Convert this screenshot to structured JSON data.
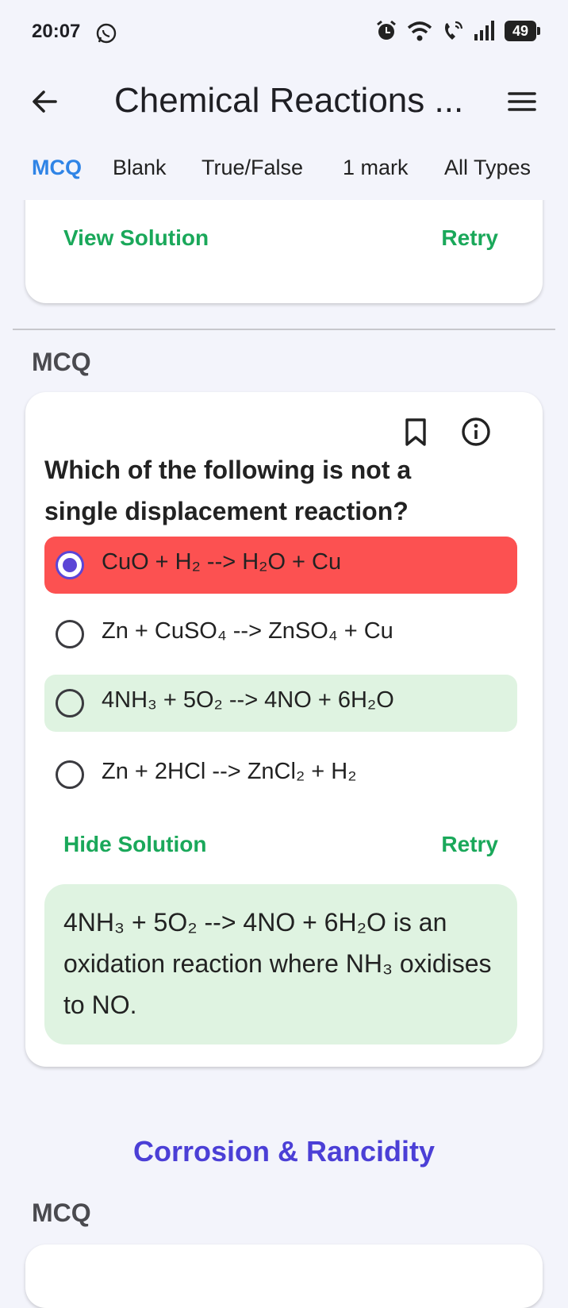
{
  "status_bar": {
    "time": "20:07",
    "battery": "49",
    "icons": [
      "whatsapp-icon",
      "alarm-icon",
      "wifi-icon",
      "wifi-call-icon",
      "signal-icon",
      "battery-icon"
    ]
  },
  "app_bar": {
    "title": "Chemical Reactions ...",
    "back_icon": "arrow-back-icon",
    "menu_icon": "menu-icon"
  },
  "tabs": [
    {
      "label": "MCQ",
      "active": true
    },
    {
      "label": "Blank",
      "active": false
    },
    {
      "label": "True/False",
      "active": false
    },
    {
      "label": "1 mark",
      "active": false
    },
    {
      "label": "All Types",
      "active": false
    }
  ],
  "previous_card": {
    "view_solution_label": "View Solution",
    "retry_label": "Retry"
  },
  "question_card": {
    "section_label": "MCQ",
    "question": "Which of the following is not a single displacement reaction?",
    "options": [
      {
        "text": "CuO + H₂ --> H₂O + Cu",
        "state": "selected-wrong"
      },
      {
        "text": "Zn + CuSO₄ --> ZnSO₄ + Cu",
        "state": "none"
      },
      {
        "text": "4NH₃ + 5O₂ --> 4NO + 6H₂O",
        "state": "correct"
      },
      {
        "text": "Zn + 2HCl --> ZnCl₂ + H₂",
        "state": "none"
      }
    ],
    "hide_solution_label": "Hide Solution",
    "retry_label": "Retry",
    "solution": "4NH₃ + 5O₂ --> 4NO + 6H₂O is an oxidation reaction where NH₃ oxidises to NO."
  },
  "next_section": {
    "topic_heading": "Corrosion & Rancidity",
    "section_label": "MCQ"
  },
  "colors": {
    "background": "#f3f4fb",
    "tab_active": "#2f84e6",
    "link_green": "#1aa85a",
    "wrong_option": "#fc5151",
    "correct_option": "#dff3e1",
    "radio_selected": "#5b45d6",
    "topic_heading": "#4b3fd6"
  }
}
